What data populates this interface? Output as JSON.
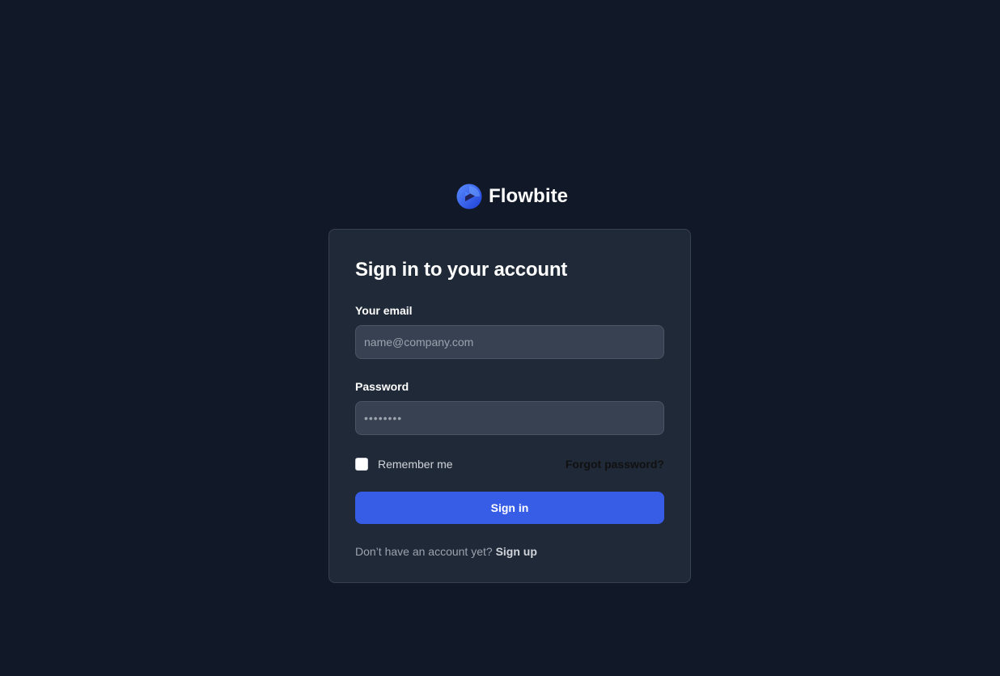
{
  "brand": {
    "name": "Flowbite",
    "logo_icon": "flowbite-logo-icon",
    "accent": "#3f5ef5"
  },
  "card": {
    "title": "Sign in to your account",
    "email": {
      "label": "Your email",
      "placeholder": "name@company.com",
      "value": ""
    },
    "password": {
      "label": "Password",
      "value": "••••••••"
    },
    "remember_label": "Remember me",
    "remember_checked": false,
    "forgot_label": "Forgot password?",
    "submit_label": "Sign in",
    "signup_prompt": "Don’t have an account yet?",
    "signup_label": "Sign up"
  },
  "colors": {
    "background": "#111827",
    "card": "#1f2937",
    "input": "#374151",
    "primary_button": "#375ce6"
  }
}
